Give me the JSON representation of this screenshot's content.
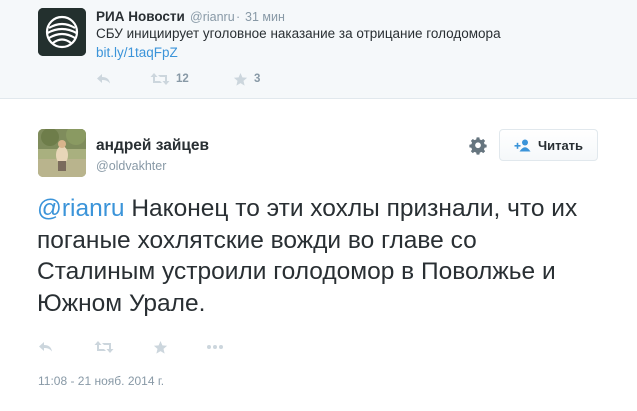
{
  "parent_tweet": {
    "author_name": "РИА Новости",
    "author_handle": "@rianru",
    "separator": "·",
    "time_ago": "31 мин",
    "text": "СБУ инициирует уголовное наказание за отрицание голодомора",
    "link": "bit.ly/1taqFpZ",
    "retweet_count": "12",
    "favorite_count": "3",
    "avatar_icon": "ria-logo-icon"
  },
  "tweet": {
    "author_name": "андрей зайцев",
    "author_handle": "@oldvakhter",
    "mention": "@rianru",
    "text": " Наконец то эти хохлы признали, что их поганые хохлятские вожди во главе со Сталиным устроили голодомор в Поволжье и Южном Урале.",
    "timestamp": "11:08 - 21 нояб. 2014 г.",
    "follow_label": "Читать",
    "actions": [
      "reply-icon",
      "retweet-icon",
      "favorite-icon",
      "more-icon"
    ]
  },
  "colors": {
    "link": "#3b94d9",
    "muted": "#8899a6",
    "text": "#292f33",
    "parent_bg": "#f5f8fa"
  }
}
